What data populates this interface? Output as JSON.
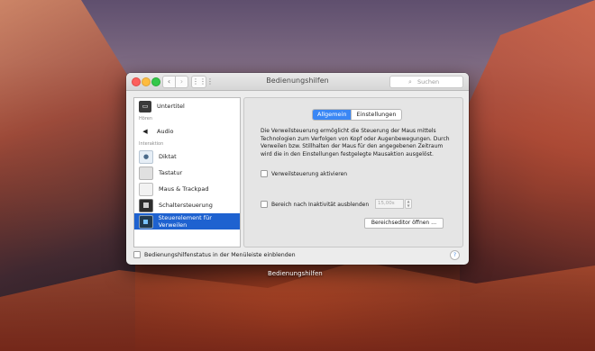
{
  "window": {
    "title": "Bedienungshilfen",
    "search_placeholder": "Suchen",
    "nav_back": "‹",
    "nav_forward": "›",
    "grid": "⋮⋮⋮"
  },
  "sidebar": {
    "items": [
      {
        "label": "Untertitel"
      },
      {
        "label": "Audio"
      },
      {
        "label": "Diktat"
      },
      {
        "label": "Tastatur"
      },
      {
        "label": "Maus & Trackpad"
      },
      {
        "label": "Schaltersteuerung"
      },
      {
        "label": "Steuerelement für Verweilen"
      }
    ],
    "sections": [
      "Hören",
      "Interaktion"
    ],
    "selected": "Steuerelement für Verweilen"
  },
  "panel": {
    "tabs": [
      "Allgemein",
      "Einstellungen"
    ],
    "active_tab": "Allgemein",
    "description": "Die Verweilsteuerung ermöglicht die Steuerung der Maus mittels Technologien zum Verfolgen von Kopf oder Augenbewegungen. Durch Verweilen bzw. Stillhalten der Maus für den angegebenen Zeitraum wird die in den Einstellungen festgelegte Mausaktion ausgelöst.",
    "checkbox_enable": "Verweilsteuerung aktivieren",
    "checkbox_hide": "Bereich nach Inaktivität ausblenden",
    "timeout_value": "15,00s",
    "editor_button": "Bereichseditor öffnen …"
  },
  "footer": {
    "menu_checkbox": "Bedienungshilfenstatus in der Menüleiste einblenden",
    "help": "?"
  },
  "dock_label": "Bedienungshilfen"
}
